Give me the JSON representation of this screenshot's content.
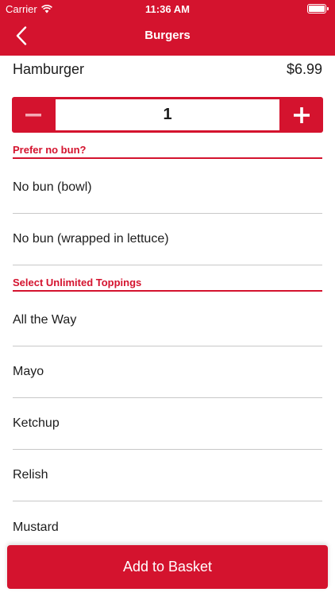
{
  "status_bar": {
    "carrier": "Carrier",
    "time": "11:36 AM"
  },
  "nav": {
    "title": "Burgers",
    "back_icon": "chevron-left-icon"
  },
  "item": {
    "name": "Hamburger",
    "price": "$6.99"
  },
  "quantity": {
    "value": "1",
    "minus_icon": "minus-icon",
    "plus_icon": "plus-icon"
  },
  "sections": [
    {
      "title": "Prefer no bun?",
      "options": [
        "No bun (bowl)",
        "No bun (wrapped in lettuce)"
      ]
    },
    {
      "title": "Select Unlimited Toppings",
      "options": [
        "All the Way",
        "Mayo",
        "Ketchup",
        "Relish",
        "Mustard"
      ]
    }
  ],
  "add_button": {
    "label": "Add to Basket"
  },
  "colors": {
    "accent": "#d4132e"
  }
}
